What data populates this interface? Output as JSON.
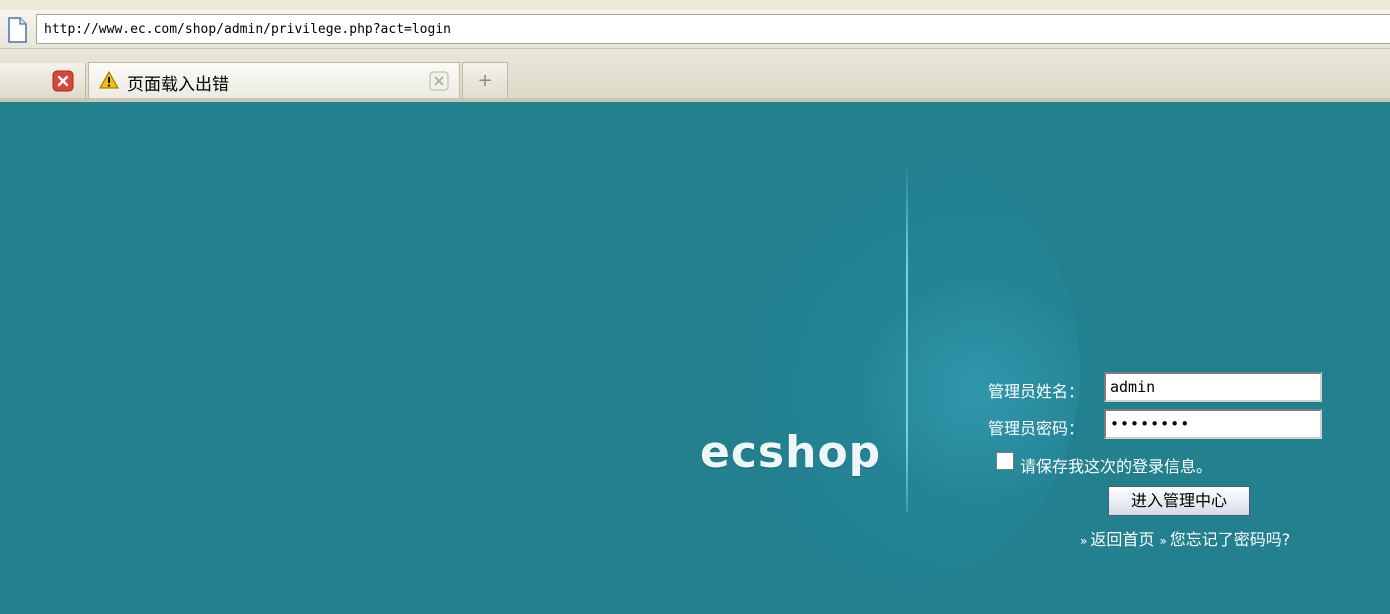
{
  "browser": {
    "url": "http://www.ec.com/shop/admin/privilege.php?act=login",
    "tab_title": "页面载入出错",
    "new_tab_label": "+"
  },
  "logo": {
    "text": "ecshop"
  },
  "login_form": {
    "username_label": "管理员姓名：",
    "username_value": "admin",
    "password_label": "管理员密码：",
    "password_value": "••••••••",
    "remember_label": "请保存我这次的登录信息。",
    "submit_label": "进入管理中心",
    "back_home_link": "返回首页",
    "forgot_password_link": "您忘记了密码吗?",
    "link_marker": "»"
  },
  "colors": {
    "background": "#22808f",
    "accent_glow": "#3aaac3"
  }
}
